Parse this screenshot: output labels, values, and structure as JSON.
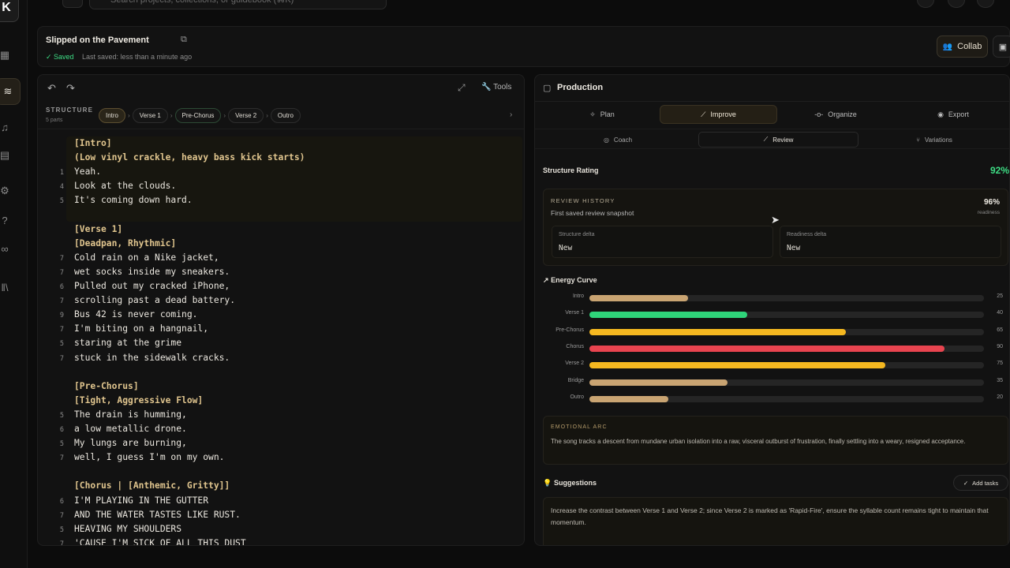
{
  "topbar": {
    "search_placeholder": "Search projects, collections, or guidebook (⌘K)"
  },
  "project": {
    "title": "Slipped on the Pavement",
    "saved_label": "✓ Saved",
    "last_saved": "Last saved: less than a minute ago",
    "collab_label": "Collab"
  },
  "editor": {
    "tools_label": "Tools",
    "structure_label": "STRUCTURE",
    "structure_count": "5 parts",
    "chips": [
      "Intro",
      "Verse 1",
      "Pre-Chorus",
      "Verse 2",
      "Outro"
    ],
    "lines": [
      {
        "n": "",
        "t": "[Intro]",
        "tag": true
      },
      {
        "n": "",
        "t": "(Low vinyl crackle, heavy bass kick starts)",
        "tag": true
      },
      {
        "n": "1",
        "t": "Yeah.",
        "tag": false
      },
      {
        "n": "4",
        "t": "Look at the clouds.",
        "tag": false
      },
      {
        "n": "5",
        "t": "It's coming down hard.",
        "tag": false
      },
      {
        "n": "",
        "t": "",
        "tag": false
      },
      {
        "n": "",
        "t": "[Verse 1]",
        "tag": true
      },
      {
        "n": "",
        "t": "[Deadpan, Rhythmic]",
        "tag": true
      },
      {
        "n": "7",
        "t": "Cold rain on a Nike jacket,",
        "tag": false
      },
      {
        "n": "7",
        "t": "wet socks inside my sneakers.",
        "tag": false
      },
      {
        "n": "6",
        "t": "Pulled out my cracked iPhone,",
        "tag": false
      },
      {
        "n": "7",
        "t": "scrolling past a dead battery.",
        "tag": false
      },
      {
        "n": "9",
        "t": "Bus 42 is never coming.",
        "tag": false
      },
      {
        "n": "7",
        "t": "I'm biting on a hangnail,",
        "tag": false
      },
      {
        "n": "5",
        "t": "staring at the grime",
        "tag": false
      },
      {
        "n": "7",
        "t": "stuck in the sidewalk cracks.",
        "tag": false
      },
      {
        "n": "",
        "t": "",
        "tag": false
      },
      {
        "n": "",
        "t": "[Pre-Chorus]",
        "tag": true
      },
      {
        "n": "",
        "t": "[Tight, Aggressive Flow]",
        "tag": true
      },
      {
        "n": "5",
        "t": "The drain is humming,",
        "tag": false
      },
      {
        "n": "6",
        "t": "a low metallic drone.",
        "tag": false
      },
      {
        "n": "5",
        "t": "My lungs are burning,",
        "tag": false
      },
      {
        "n": "7",
        "t": "well, I guess I'm on my own.",
        "tag": false
      },
      {
        "n": "",
        "t": "",
        "tag": false
      },
      {
        "n": "",
        "t": "[Chorus | [Anthemic, Gritty]]",
        "tag": true
      },
      {
        "n": "6",
        "t": "I'M PLAYING IN THE GUTTER",
        "tag": false
      },
      {
        "n": "7",
        "t": "AND THE WATER TASTES LIKE RUST.",
        "tag": false
      },
      {
        "n": "5",
        "t": "HEAVING MY SHOULDERS",
        "tag": false
      },
      {
        "n": "7",
        "t": "'CAUSE I'M SICK OF ALL THIS DUST",
        "tag": false
      }
    ]
  },
  "production": {
    "title": "Production",
    "tabs": [
      "Plan",
      "Improve",
      "Organize",
      "Export"
    ],
    "subtabs": [
      "Coach",
      "Review",
      "Variations"
    ],
    "structure_rating_label": "Structure Rating",
    "structure_rating": "92%",
    "review": {
      "label": "REVIEW HISTORY",
      "subtitle": "First saved review snapshot",
      "value": "96%",
      "caption": "readiness",
      "structure_delta_label": "Structure delta",
      "structure_delta": "New",
      "readiness_delta_label": "Readiness delta",
      "readiness_delta": "New"
    },
    "energy_label": "Energy Curve",
    "energy": [
      {
        "name": "Intro",
        "value": 25,
        "color": "#c9a472"
      },
      {
        "name": "Verse 1",
        "value": 40,
        "color": "#2fd47a"
      },
      {
        "name": "Pre-Chorus",
        "value": 65,
        "color": "#f5b820"
      },
      {
        "name": "Chorus",
        "value": 90,
        "color": "#e8444f"
      },
      {
        "name": "Verse 2",
        "value": 75,
        "color": "#f5b820"
      },
      {
        "name": "Bridge",
        "value": 35,
        "color": "#c9a472"
      },
      {
        "name": "Outro",
        "value": 20,
        "color": "#c9a472"
      }
    ],
    "arc_label": "EMOTIONAL ARC",
    "arc_text": "The song tracks a descent from mundane urban isolation into a raw, visceral outburst of frustration, finally settling into a weary, resigned acceptance.",
    "suggestions_label": "Suggestions",
    "add_tasks": "Add tasks",
    "suggestion": "Increase the contrast between Verse 1 and Verse 2; since Verse 2 is marked as 'Rapid-Fire', ensure the syllable count remains tight to maintain that momentum."
  }
}
